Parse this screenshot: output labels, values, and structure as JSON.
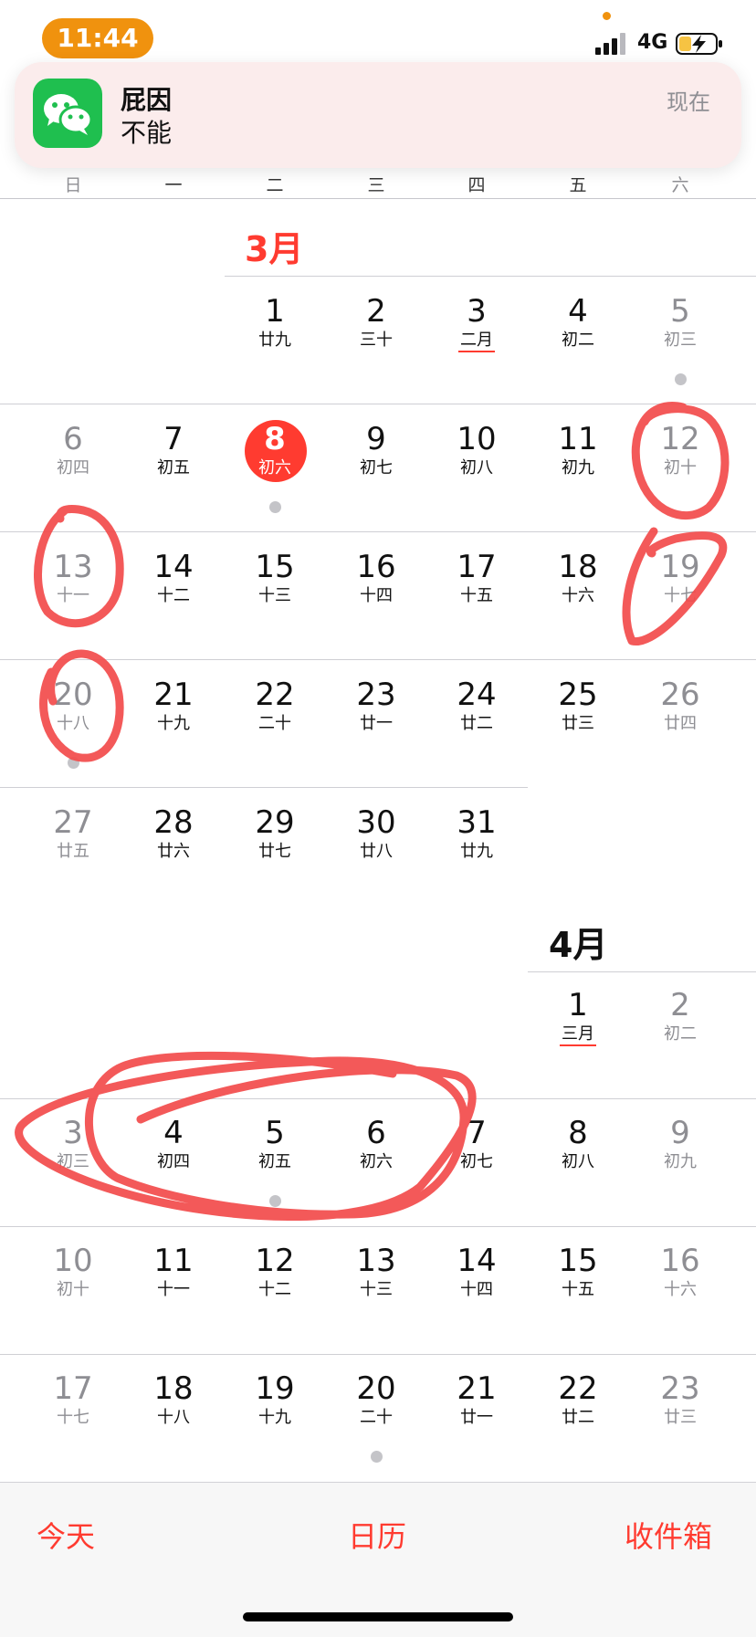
{
  "status_bar": {
    "time": "11:44",
    "network": "4G"
  },
  "notification": {
    "title": "屁因",
    "body": "不能",
    "time": "现在",
    "app_icon": "wechat-icon"
  },
  "weekdays": [
    "日",
    "一",
    "二",
    "三",
    "四",
    "五",
    "六"
  ],
  "months": {
    "march": {
      "title": "3月"
    },
    "april": {
      "title": "4月"
    }
  },
  "days": {
    "mar01": {
      "num": "1",
      "lunar": "廿九"
    },
    "mar02": {
      "num": "2",
      "lunar": "三十"
    },
    "mar03": {
      "num": "3",
      "lunar": "二月"
    },
    "mar04": {
      "num": "4",
      "lunar": "初二"
    },
    "mar05": {
      "num": "5",
      "lunar": "初三"
    },
    "mar06": {
      "num": "6",
      "lunar": "初四"
    },
    "mar07": {
      "num": "7",
      "lunar": "初五"
    },
    "mar08": {
      "num": "8",
      "lunar": "初六"
    },
    "mar09": {
      "num": "9",
      "lunar": "初七"
    },
    "mar10": {
      "num": "10",
      "lunar": "初八"
    },
    "mar11": {
      "num": "11",
      "lunar": "初九"
    },
    "mar12": {
      "num": "12",
      "lunar": "初十"
    },
    "mar13": {
      "num": "13",
      "lunar": "十一"
    },
    "mar14": {
      "num": "14",
      "lunar": "十二"
    },
    "mar15": {
      "num": "15",
      "lunar": "十三"
    },
    "mar16": {
      "num": "16",
      "lunar": "十四"
    },
    "mar17": {
      "num": "17",
      "lunar": "十五"
    },
    "mar18": {
      "num": "18",
      "lunar": "十六"
    },
    "mar19": {
      "num": "19",
      "lunar": "十七"
    },
    "mar20": {
      "num": "20",
      "lunar": "十八"
    },
    "mar21": {
      "num": "21",
      "lunar": "十九"
    },
    "mar22": {
      "num": "22",
      "lunar": "二十"
    },
    "mar23": {
      "num": "23",
      "lunar": "廿一"
    },
    "mar24": {
      "num": "24",
      "lunar": "廿二"
    },
    "mar25": {
      "num": "25",
      "lunar": "廿三"
    },
    "mar26": {
      "num": "26",
      "lunar": "廿四"
    },
    "mar27": {
      "num": "27",
      "lunar": "廿五"
    },
    "mar28": {
      "num": "28",
      "lunar": "廿六"
    },
    "mar29": {
      "num": "29",
      "lunar": "廿七"
    },
    "mar30": {
      "num": "30",
      "lunar": "廿八"
    },
    "mar31": {
      "num": "31",
      "lunar": "廿九"
    },
    "apr01": {
      "num": "1",
      "lunar": "三月"
    },
    "apr02": {
      "num": "2",
      "lunar": "初二"
    },
    "apr03": {
      "num": "3",
      "lunar": "初三"
    },
    "apr04": {
      "num": "4",
      "lunar": "初四"
    },
    "apr05": {
      "num": "5",
      "lunar": "初五"
    },
    "apr06": {
      "num": "6",
      "lunar": "初六"
    },
    "apr07": {
      "num": "7",
      "lunar": "初七"
    },
    "apr08": {
      "num": "8",
      "lunar": "初八"
    },
    "apr09": {
      "num": "9",
      "lunar": "初九"
    },
    "apr10": {
      "num": "10",
      "lunar": "初十"
    },
    "apr11": {
      "num": "11",
      "lunar": "十一"
    },
    "apr12": {
      "num": "12",
      "lunar": "十二"
    },
    "apr13": {
      "num": "13",
      "lunar": "十三"
    },
    "apr14": {
      "num": "14",
      "lunar": "十四"
    },
    "apr15": {
      "num": "15",
      "lunar": "十五"
    },
    "apr16": {
      "num": "16",
      "lunar": "十六"
    },
    "apr17": {
      "num": "17",
      "lunar": "十七"
    },
    "apr18": {
      "num": "18",
      "lunar": "十八"
    },
    "apr19": {
      "num": "19",
      "lunar": "十九"
    },
    "apr20": {
      "num": "20",
      "lunar": "二十"
    },
    "apr21": {
      "num": "21",
      "lunar": "廿一"
    },
    "apr22": {
      "num": "22",
      "lunar": "廿二"
    },
    "apr23": {
      "num": "23",
      "lunar": "廿三"
    }
  },
  "today": "mar08",
  "tab_bar": {
    "today": "今天",
    "calendars": "日历",
    "inbox": "收件箱"
  },
  "colors": {
    "accent": "#ff3b30",
    "annotation": "#f24b4b",
    "time_pill": "#f0920e",
    "wechat": "#1fbf4f"
  }
}
